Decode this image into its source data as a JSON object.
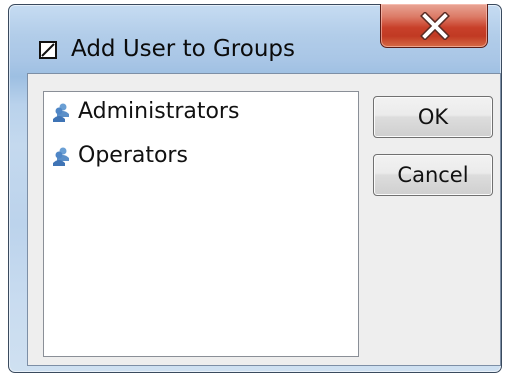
{
  "window": {
    "title": "Add User to Groups",
    "title_icon": "checkbox-square-icon",
    "close_icon": "close-x-icon",
    "close_color": "#c8402a"
  },
  "groups_list": {
    "items": [
      {
        "label": "Administrators",
        "icon": "user-group-icon"
      },
      {
        "label": "Operators",
        "icon": "user-group-icon"
      }
    ]
  },
  "buttons": {
    "ok_label": "OK",
    "cancel_label": "Cancel"
  }
}
